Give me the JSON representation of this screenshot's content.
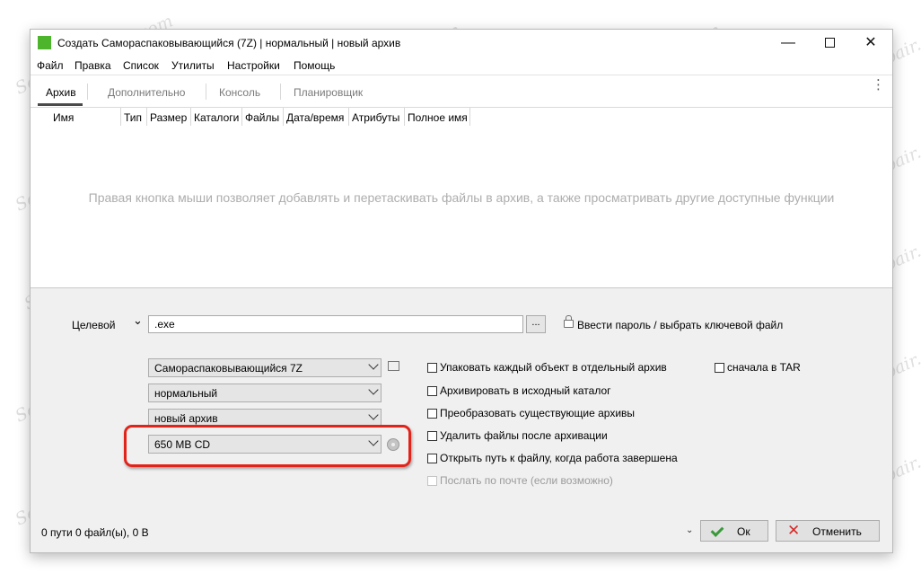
{
  "window": {
    "title": "Создать Самораспаковывающийся (7Z) | нормальный | новый архив",
    "min_glyph": "—",
    "close_glyph": "✕"
  },
  "menu": [
    "Файл",
    "Правка",
    "Список",
    "Утилиты",
    "Настройки",
    "Помощь"
  ],
  "tabs": [
    {
      "label": "Архив",
      "active": true
    },
    {
      "label": "Дополнительно",
      "active": false
    },
    {
      "label": "Консоль",
      "active": false
    },
    {
      "label": "Планировщик",
      "active": false
    }
  ],
  "kebab_glyph": "⋮",
  "columns": [
    "Имя",
    "Тип",
    "Размер",
    "Каталоги",
    "Файлы",
    "Дата/время",
    "Атрибуты",
    "Полное имя"
  ],
  "empty_hint": "Правая кнопка мыши позволяет добавлять и перетаскивать файлы в архив, а также просматривать другие доступные функции",
  "target": {
    "label": "Целевой",
    "chevron": "⌄",
    "value": ".exe",
    "browse": "...",
    "password_link": "Ввести пароль / выбрать ключевой файл"
  },
  "options": {
    "format": "Самораспаковывающийся 7Z",
    "compression": "нормальный",
    "mode": "новый архив",
    "split": "650 MB CD"
  },
  "checkboxes": {
    "each_object": "Упаковать каждый объект в отдельный архив",
    "tar_first": "сначала в TAR",
    "source_dir": "Архивировать в исходный каталог",
    "convert": "Преобразовать существующие архивы",
    "delete_after": "Удалить файлы после архивации",
    "open_path": "Открыть путь к файлу, когда работа завершена",
    "send_mail": "Послать по почте (если возможно)"
  },
  "status": "0 пути 0 файл(ы), 0 B",
  "buttons": {
    "expand_glyph": "⌄",
    "ok": "Ок",
    "cancel": "Отменить",
    "cancel_glyph": "✕"
  },
  "watermark": "Soringpcrepair.com",
  "colors": {
    "highlight": "#e2231a",
    "app_icon": "#4cb52b",
    "ok_icon": "#3a9a3a",
    "cancel_icon": "#d42a2a"
  }
}
